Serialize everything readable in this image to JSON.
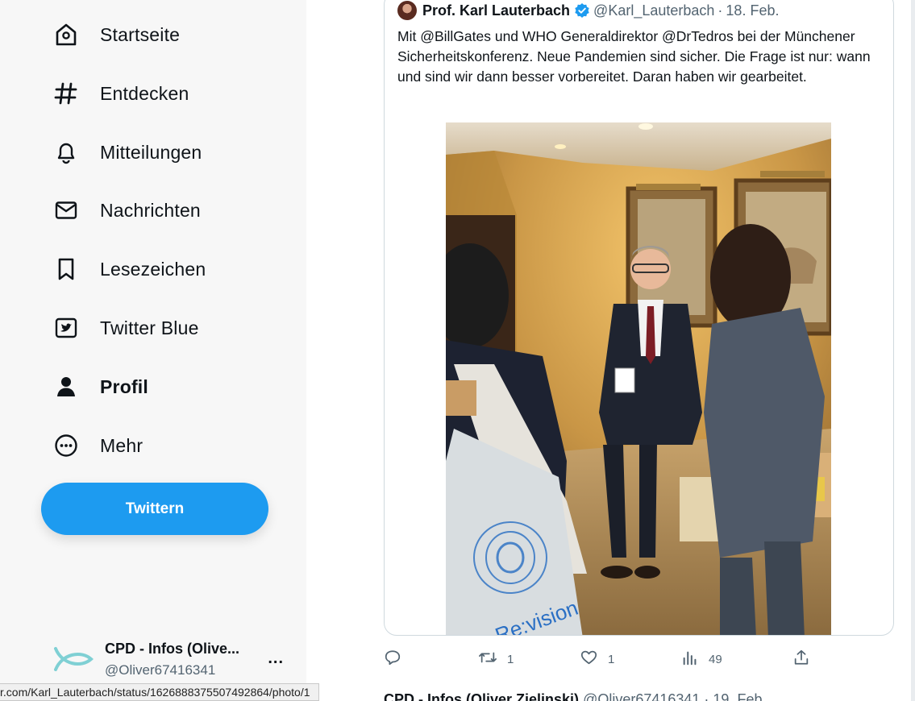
{
  "sidebar": {
    "items": [
      {
        "label": "Startseite",
        "icon": "home-icon"
      },
      {
        "label": "Entdecken",
        "icon": "hashtag-icon"
      },
      {
        "label": "Mitteilungen",
        "icon": "bell-icon"
      },
      {
        "label": "Nachrichten",
        "icon": "envelope-icon"
      },
      {
        "label": "Lesezeichen",
        "icon": "bookmark-icon"
      },
      {
        "label": "Twitter Blue",
        "icon": "twitter-blue-icon"
      },
      {
        "label": "Profil",
        "icon": "person-icon",
        "active": true
      },
      {
        "label": "Mehr",
        "icon": "more-circle-icon"
      }
    ],
    "tweet_button": "Twittern",
    "account": {
      "name": "CPD - Infos (Olive...",
      "handle": "@Oliver67416341",
      "more": "..."
    }
  },
  "quoted_tweet": {
    "author_name": "Prof. Karl Lauterbach",
    "author_handle": "@Karl_Lauterbach",
    "separator": "·",
    "date": "18. Feb.",
    "text": "Mit @BillGates und WHO Generaldirektor @DrTedros bei der Münchener Sicherheitskonferenz. Neue Pandemien sind sicher. Die Frage ist nur: wann und sind wir dann besser vorbereitet. Daran haben wir gearbeitet.",
    "photo_bag_text": "Re:vision"
  },
  "actions": {
    "reply": "",
    "retweet": "1",
    "like": "1",
    "views": "49",
    "share": ""
  },
  "next_tweet": {
    "name": "CPD - Infos (Oliver Zielinski)",
    "handle_date": "@Oliver67416341 · 19. Feb."
  },
  "status_bar": {
    "url": "r.com/Karl_Lauterbach/status/1626888375507492864/photo/1"
  },
  "colors": {
    "accent": "#1d9bf0",
    "text": "#0f1419",
    "muted": "#536471"
  }
}
